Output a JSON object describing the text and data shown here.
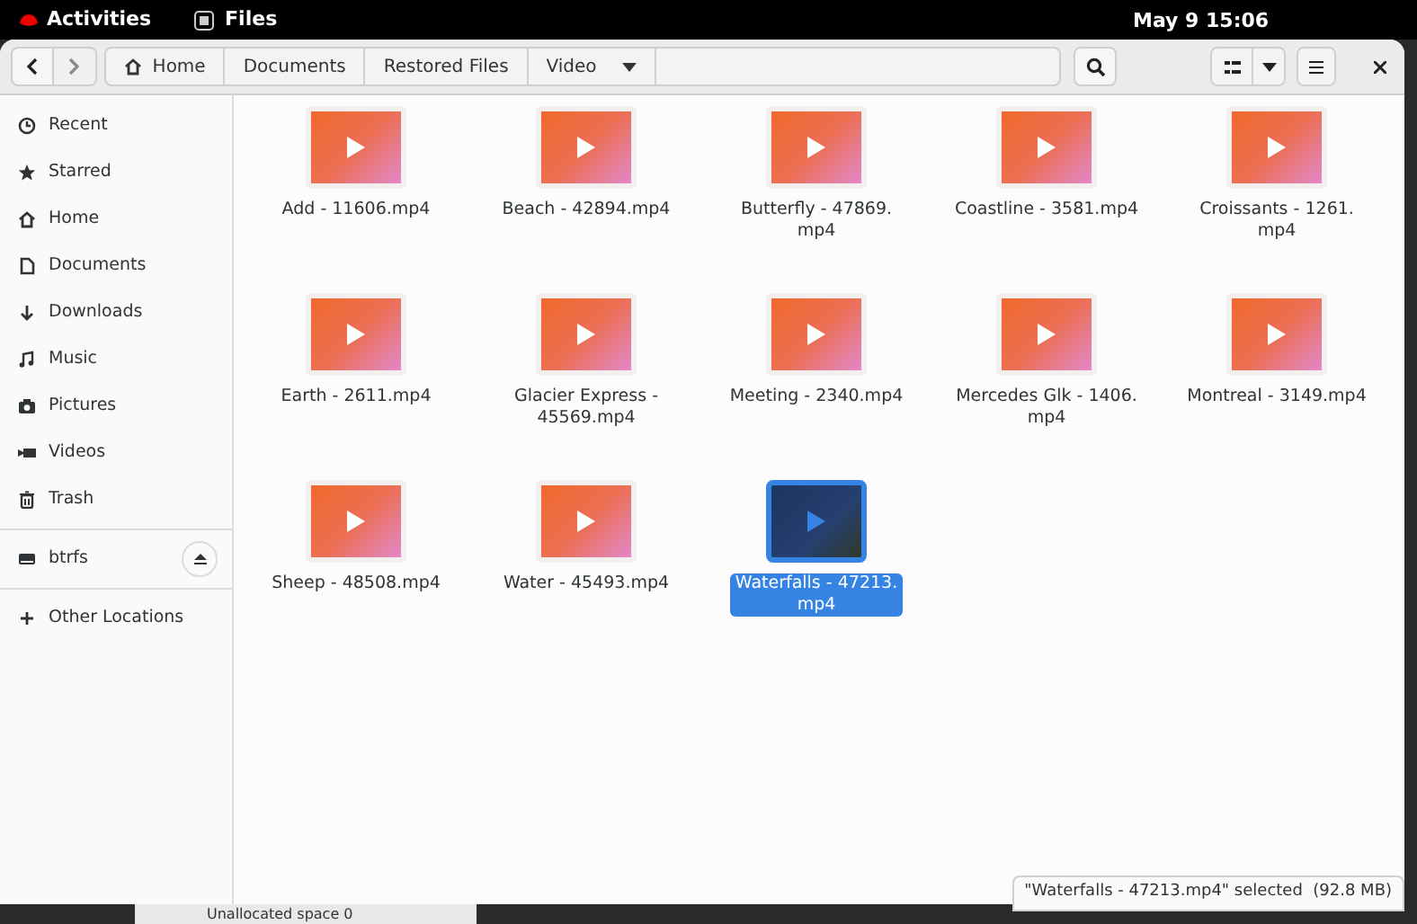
{
  "top_bar": {
    "activities": "Activities",
    "app": "Files",
    "clock": "May 9  15:06"
  },
  "path_bar": {
    "segments": [
      "Home",
      "Documents",
      "Restored Files",
      "Video"
    ]
  },
  "sidebar": {
    "places": [
      {
        "label": "Recent"
      },
      {
        "label": "Starred"
      },
      {
        "label": "Home"
      },
      {
        "label": "Documents"
      },
      {
        "label": "Downloads"
      },
      {
        "label": "Music"
      },
      {
        "label": "Pictures"
      },
      {
        "label": "Videos"
      },
      {
        "label": "Trash"
      }
    ],
    "devices": [
      {
        "label": "btrfs"
      }
    ],
    "other": {
      "label": "Other Locations"
    }
  },
  "files": [
    {
      "lines": [
        "Add - 11606.mp4"
      ],
      "selected": false
    },
    {
      "lines": [
        "Beach - 42894.mp4"
      ],
      "selected": false
    },
    {
      "lines": [
        "Butterfly - 47869.",
        "mp4"
      ],
      "selected": false
    },
    {
      "lines": [
        "Coastline - 3581.mp4"
      ],
      "selected": false
    },
    {
      "lines": [
        "Croissants - 1261.",
        "mp4"
      ],
      "selected": false
    },
    {
      "lines": [
        "Earth - 2611.mp4"
      ],
      "selected": false
    },
    {
      "lines": [
        "Glacier Express -",
        "45569.mp4"
      ],
      "selected": false
    },
    {
      "lines": [
        "Meeting - 2340.mp4"
      ],
      "selected": false
    },
    {
      "lines": [
        "Mercedes Glk - 1406.",
        "mp4"
      ],
      "selected": false
    },
    {
      "lines": [
        "Montreal - 3149.mp4"
      ],
      "selected": false
    },
    {
      "lines": [
        "Sheep - 48508.mp4"
      ],
      "selected": false
    },
    {
      "lines": [
        "Water - 45493.mp4"
      ],
      "selected": false
    },
    {
      "lines": [
        "Waterfalls - 47213.",
        "mp4"
      ],
      "selected": true
    }
  ],
  "status": "\"Waterfalls - 47213.mp4\" selected  (92.8 MB)",
  "background_window": {
    "text": "Unallocated space 0"
  }
}
